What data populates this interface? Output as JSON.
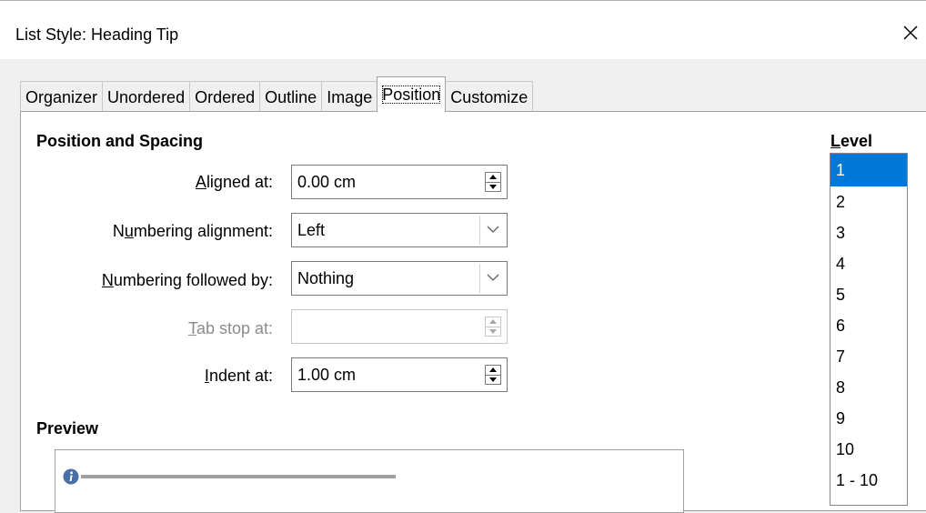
{
  "window": {
    "title": "List Style: Heading Tip"
  },
  "tabs": [
    {
      "label": "Organizer"
    },
    {
      "label": "Unordered"
    },
    {
      "label": "Ordered"
    },
    {
      "label": "Outline"
    },
    {
      "label": "Image"
    },
    {
      "label": "Position"
    },
    {
      "label": "Customize"
    }
  ],
  "active_tab": "Position",
  "position_spacing": {
    "title": "Position and Spacing",
    "aligned_at": {
      "label_pre": "",
      "label_mnemonic": "A",
      "label_post": "ligned at:",
      "value": "0.00 cm"
    },
    "numbering_alignment": {
      "label_pre": "N",
      "label_mnemonic": "u",
      "label_post": "mbering alignment:",
      "value": "Left"
    },
    "numbering_followed_by": {
      "label_pre": "",
      "label_mnemonic": "N",
      "label_post": "umbering followed by:",
      "value": "Nothing"
    },
    "tab_stop_at": {
      "label_pre": "",
      "label_mnemonic": "T",
      "label_post": "ab stop at:",
      "value": ""
    },
    "indent_at": {
      "label_pre": "",
      "label_mnemonic": "I",
      "label_post": "ndent at:",
      "value": "1.00 cm"
    }
  },
  "preview": {
    "title": "Preview"
  },
  "level": {
    "title_mnemonic": "L",
    "title_rest": "evel",
    "items": [
      "1",
      "2",
      "3",
      "4",
      "5",
      "6",
      "7",
      "8",
      "9",
      "10",
      "1 - 10"
    ],
    "selected": "1"
  },
  "colors": {
    "selection": "#0078d7",
    "disabled_text": "#8c8c8c",
    "info_icon": "#4a6fa5"
  },
  "icons": {
    "close": "close-icon",
    "info": "info-icon",
    "dropdown": "chevron-down-icon"
  }
}
